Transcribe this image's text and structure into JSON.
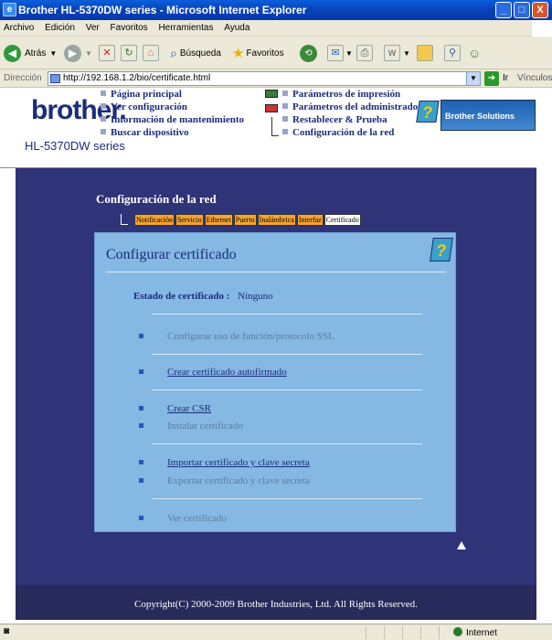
{
  "window": {
    "title": "Brother HL-5370DW series - Microsoft Internet Explorer",
    "minimize": "_",
    "maximize": "□",
    "close": "X"
  },
  "menu": [
    "Archivo",
    "Edición",
    "Ver",
    "Favoritos",
    "Herramientas",
    "Ayuda"
  ],
  "toolbar": {
    "back_label": "Atrás",
    "search_label": "Búsqueda",
    "favorites_label": "Favoritos"
  },
  "address": {
    "label": "Dirección",
    "url": "http://192.168.1.2/bio/certificate.html",
    "go_label": "Ir",
    "links_label": "Vínculos"
  },
  "brand": {
    "logo": "brother.",
    "model": "HL-5370DW series",
    "solutions": "Brother Solutions Center",
    "help_glyph": "?"
  },
  "nav_left": [
    "Página principal",
    "Ver configuración",
    "Información de mantenimiento",
    "Buscar dispositivo"
  ],
  "nav_right": [
    "Parámetros de impresión",
    "Parámetros del administrador",
    "Restablecer & Prueba",
    "Configuración de la red"
  ],
  "section": {
    "title": "Configuración de la red",
    "tabs": [
      "Notificación",
      "Servicio",
      "Ethernet",
      "Puerto",
      "Inalámbrica",
      "Interfaz",
      "Certificado"
    ]
  },
  "panel": {
    "title": "Configurar certificado",
    "status_label": "Estado de certificado :",
    "status_value": "Ninguno",
    "items": [
      "Configurar uso de función/protocolo SSL",
      "Crear certificado autofirmado",
      "Crear CSR",
      "Instalar certificado",
      "Importar certificado y clave secreta",
      "Exportar certificado y clave secreta",
      "Ver certificado"
    ]
  },
  "footer": {
    "copyright": "Copyright(C) 2000-2009 Brother Industries, Ltd. All Rights Reserved."
  },
  "statusbar": {
    "zone": "Internet"
  }
}
